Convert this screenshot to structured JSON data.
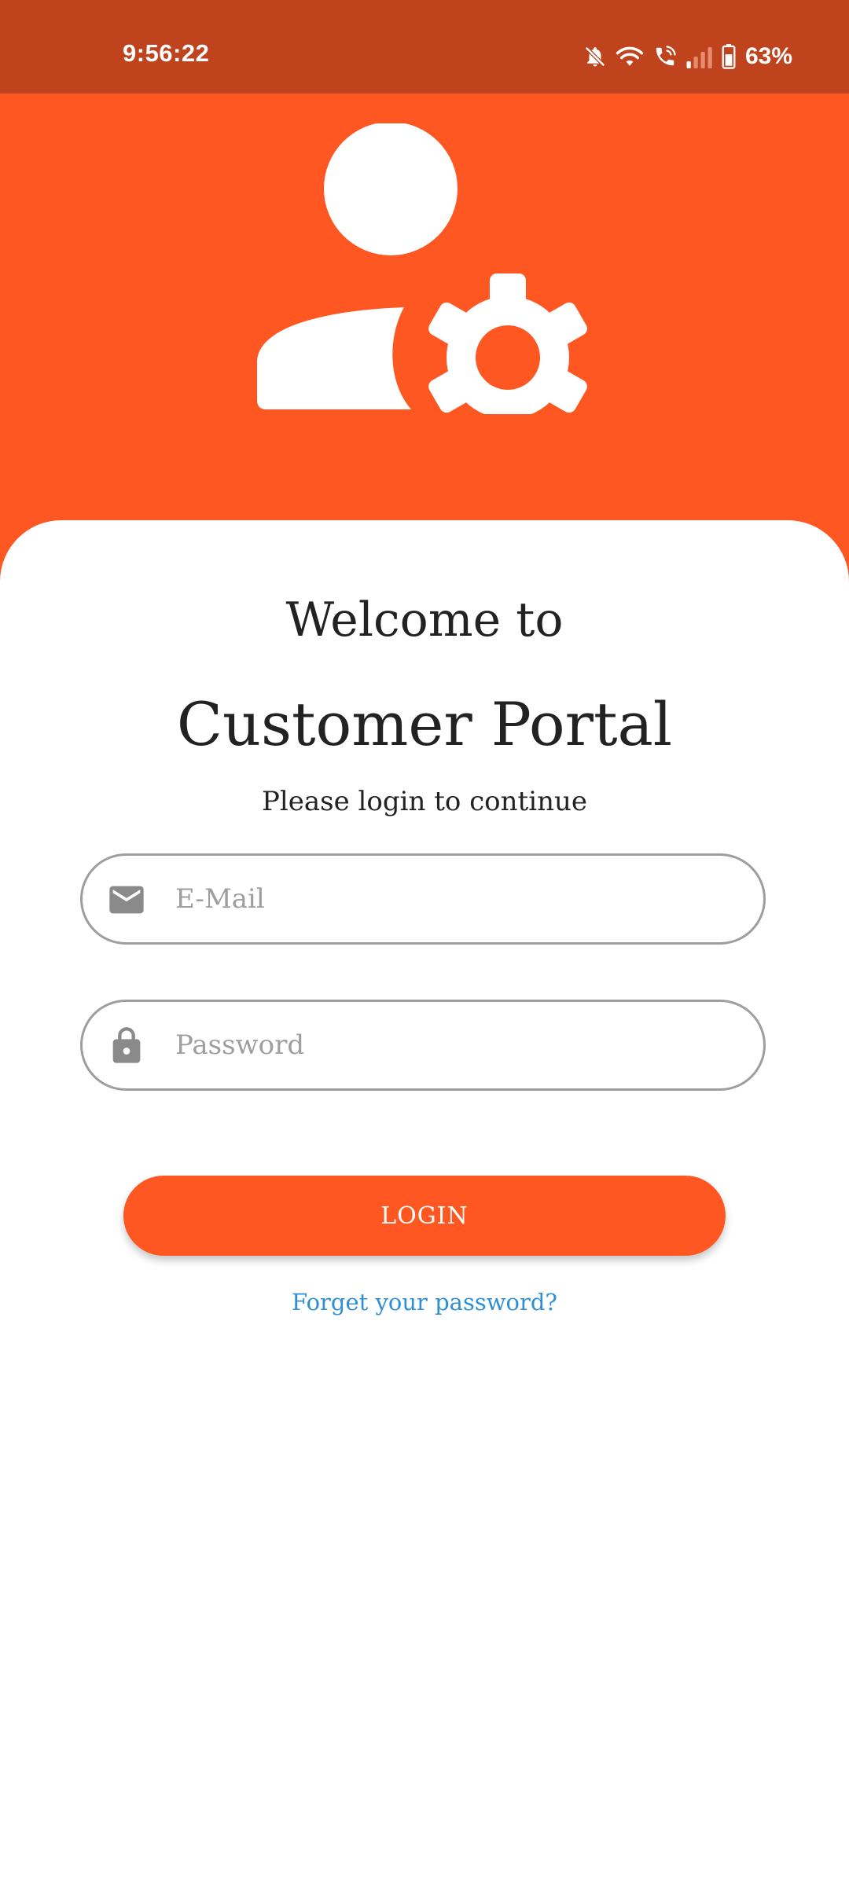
{
  "status_bar": {
    "time": "9:56:22",
    "battery": "63%",
    "icons": [
      "bell-off-icon",
      "wifi-icon",
      "wifi-calling-icon",
      "signal-icon",
      "battery-icon"
    ]
  },
  "header": {
    "icon": "user-settings-icon"
  },
  "login": {
    "welcome": "Welcome to",
    "app_name": "Customer Portal",
    "subtitle": "Please login to continue",
    "email": {
      "placeholder": "E-Mail",
      "value": "",
      "icon": "mail-icon"
    },
    "password": {
      "placeholder": "Password",
      "value": "",
      "icon": "lock-icon"
    },
    "login_button": "LOGIN",
    "forgot_password": "Forget your password?"
  },
  "colors": {
    "accent": "#ff5722",
    "status_bar": "#bf431d",
    "link": "#2d8fd5",
    "field_border": "#9e9e9e"
  }
}
